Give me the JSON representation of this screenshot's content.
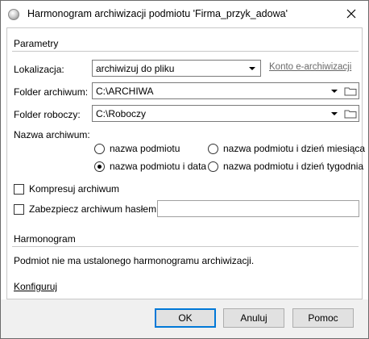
{
  "window": {
    "title": "Harmonogram archiwizacji podmiotu 'Firma_przyk_adowa'"
  },
  "parametry": {
    "section_title": "Parametry",
    "lokalizacja_label": "Lokalizacja:",
    "lokalizacja_value": "archiwizuj do pliku",
    "konto_link": "Konto e-archiwizacji",
    "folder_archiwum_label": "Folder archiwum:",
    "folder_archiwum_value": "C:\\ARCHIWA",
    "folder_roboczy_label": "Folder roboczy:",
    "folder_roboczy_value": "C:\\Roboczy",
    "nazwa_archiwum_label": "Nazwa archiwum:",
    "radio_options": [
      {
        "label": "nazwa podmiotu",
        "selected": false
      },
      {
        "label": "nazwa podmiotu i dzień miesiąca",
        "selected": false
      },
      {
        "label": "nazwa podmiotu i data",
        "selected": true
      },
      {
        "label": "nazwa podmiotu i dzień tygodnia",
        "selected": false
      }
    ],
    "kompresuj_label": "Kompresuj archiwum",
    "kompresuj_checked": false,
    "zabezpiecz_label": "Zabezpiecz archiwum hasłem:",
    "zabezpiecz_checked": false,
    "password_value": ""
  },
  "harmonogram": {
    "section_title": "Harmonogram",
    "message": "Podmiot nie ma ustalonego harmonogramu archiwizacji.",
    "konfiguruj_link": "Konfiguruj"
  },
  "buttons": {
    "ok": "OK",
    "cancel": "Anuluj",
    "help": "Pomoc"
  },
  "icons": {
    "app": "app-globe-icon",
    "close": "close-icon",
    "dropdown": "chevron-down-icon",
    "folder": "folder-icon"
  },
  "colors": {
    "default_button_border": "#0078d7",
    "footer_bg": "#f0f0f0",
    "muted_link": "#6a6a6a"
  }
}
